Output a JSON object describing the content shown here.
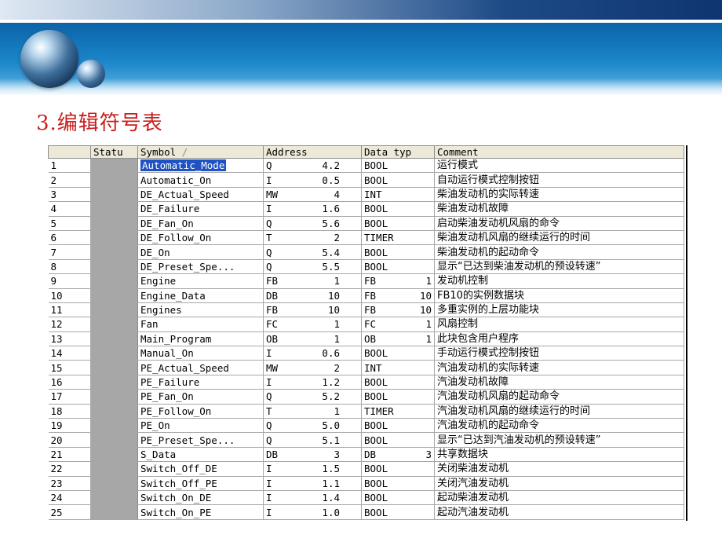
{
  "slide_title": "3.编辑符号表",
  "headers": {
    "no": "",
    "status": "Statu",
    "symbol": "Symbol",
    "sort_indicator": "/",
    "address": "Address",
    "datatype": "Data typ",
    "comment": "Comment"
  },
  "rows": [
    {
      "no": "1",
      "symbol": "Automatic_Mode",
      "addr_prefix": "Q",
      "addr_num": "4.2",
      "dtype": "BOOL",
      "dnum": "",
      "comment": "运行模式"
    },
    {
      "no": "2",
      "symbol": "Automatic_On",
      "addr_prefix": "I",
      "addr_num": "0.5",
      "dtype": "BOOL",
      "dnum": "",
      "comment": "自动运行模式控制按钮"
    },
    {
      "no": "3",
      "symbol": "DE_Actual_Speed",
      "addr_prefix": "MW",
      "addr_num": "4",
      "dtype": "INT",
      "dnum": "",
      "comment": "柴油发动机的实际转速"
    },
    {
      "no": "4",
      "symbol": "DE_Failure",
      "addr_prefix": "I",
      "addr_num": "1.6",
      "dtype": "BOOL",
      "dnum": "",
      "comment": "柴油发动机故障"
    },
    {
      "no": "5",
      "symbol": "DE_Fan_On",
      "addr_prefix": "Q",
      "addr_num": "5.6",
      "dtype": "BOOL",
      "dnum": "",
      "comment": "启动柴油发动机风扇的命令"
    },
    {
      "no": "6",
      "symbol": "DE_Follow_On",
      "addr_prefix": "T",
      "addr_num": "2",
      "dtype": "TIMER",
      "dnum": "",
      "comment": "柴油发动机风扇的继续运行的时间"
    },
    {
      "no": "7",
      "symbol": "DE_On",
      "addr_prefix": "Q",
      "addr_num": "5.4",
      "dtype": "BOOL",
      "dnum": "",
      "comment": "柴油发动机的起动命令"
    },
    {
      "no": "8",
      "symbol": "DE_Preset_Spe...",
      "addr_prefix": "Q",
      "addr_num": "5.5",
      "dtype": "BOOL",
      "dnum": "",
      "comment": "显示“已达到柴油发动机的预设转速”"
    },
    {
      "no": "9",
      "symbol": "Engine",
      "addr_prefix": "FB",
      "addr_num": "1",
      "dtype": "FB",
      "dnum": "1",
      "comment": "发动机控制"
    },
    {
      "no": "10",
      "symbol": "Engine_Data",
      "addr_prefix": "DB",
      "addr_num": "10",
      "dtype": "FB",
      "dnum": "10",
      "comment": "FB10的实例数据块"
    },
    {
      "no": "11",
      "symbol": "Engines",
      "addr_prefix": "FB",
      "addr_num": "10",
      "dtype": "FB",
      "dnum": "10",
      "comment": "多重实例的上层功能块"
    },
    {
      "no": "12",
      "symbol": "Fan",
      "addr_prefix": "FC",
      "addr_num": "1",
      "dtype": "FC",
      "dnum": "1",
      "comment": "风扇控制"
    },
    {
      "no": "13",
      "symbol": "Main_Program",
      "addr_prefix": "OB",
      "addr_num": "1",
      "dtype": "OB",
      "dnum": "1",
      "comment": "此块包含用户程序"
    },
    {
      "no": "14",
      "symbol": "Manual_On",
      "addr_prefix": "I",
      "addr_num": "0.6",
      "dtype": "BOOL",
      "dnum": "",
      "comment": "手动运行模式控制按钮"
    },
    {
      "no": "15",
      "symbol": "PE_Actual_Speed",
      "addr_prefix": "MW",
      "addr_num": "2",
      "dtype": "INT",
      "dnum": "",
      "comment": "汽油发动机的实际转速"
    },
    {
      "no": "16",
      "symbol": "PE_Failure",
      "addr_prefix": "I",
      "addr_num": "1.2",
      "dtype": "BOOL",
      "dnum": "",
      "comment": "汽油发动机故障"
    },
    {
      "no": "17",
      "symbol": "PE_Fan_On",
      "addr_prefix": "Q",
      "addr_num": "5.2",
      "dtype": "BOOL",
      "dnum": "",
      "comment": "汽油发动机风扇的起动命令"
    },
    {
      "no": "18",
      "symbol": "PE_Follow_On",
      "addr_prefix": "T",
      "addr_num": "1",
      "dtype": "TIMER",
      "dnum": "",
      "comment": "汽油发动机风扇的继续运行的时间"
    },
    {
      "no": "19",
      "symbol": "PE_On",
      "addr_prefix": "Q",
      "addr_num": "5.0",
      "dtype": "BOOL",
      "dnum": "",
      "comment": "汽油发动机的起动命令"
    },
    {
      "no": "20",
      "symbol": "PE_Preset_Spe...",
      "addr_prefix": "Q",
      "addr_num": "5.1",
      "dtype": "BOOL",
      "dnum": "",
      "comment": "显示“已达到汽油发动机的预设转速”"
    },
    {
      "no": "21",
      "symbol": "S_Data",
      "addr_prefix": "DB",
      "addr_num": "3",
      "dtype": "DB",
      "dnum": "3",
      "comment": "共享数据块"
    },
    {
      "no": "22",
      "symbol": "Switch_Off_DE",
      "addr_prefix": "I",
      "addr_num": "1.5",
      "dtype": "BOOL",
      "dnum": "",
      "comment": "关闭柴油发动机"
    },
    {
      "no": "23",
      "symbol": "Switch_Off_PE",
      "addr_prefix": "I",
      "addr_num": "1.1",
      "dtype": "BOOL",
      "dnum": "",
      "comment": "关闭汽油发动机"
    },
    {
      "no": "24",
      "symbol": "Switch_On_DE",
      "addr_prefix": "I",
      "addr_num": "1.4",
      "dtype": "BOOL",
      "dnum": "",
      "comment": "起动柴油发动机"
    },
    {
      "no": "25",
      "symbol": "Switch_On_PE",
      "addr_prefix": "I",
      "addr_num": "1.0",
      "dtype": "BOOL",
      "dnum": "",
      "comment": "起动汽油发动机"
    }
  ],
  "selected_row": 0,
  "colors": {
    "title": "#c81e1e",
    "selection": "#1f52c2",
    "status_cell": "#a7a7a7",
    "header_bg": "#ece9d8"
  }
}
